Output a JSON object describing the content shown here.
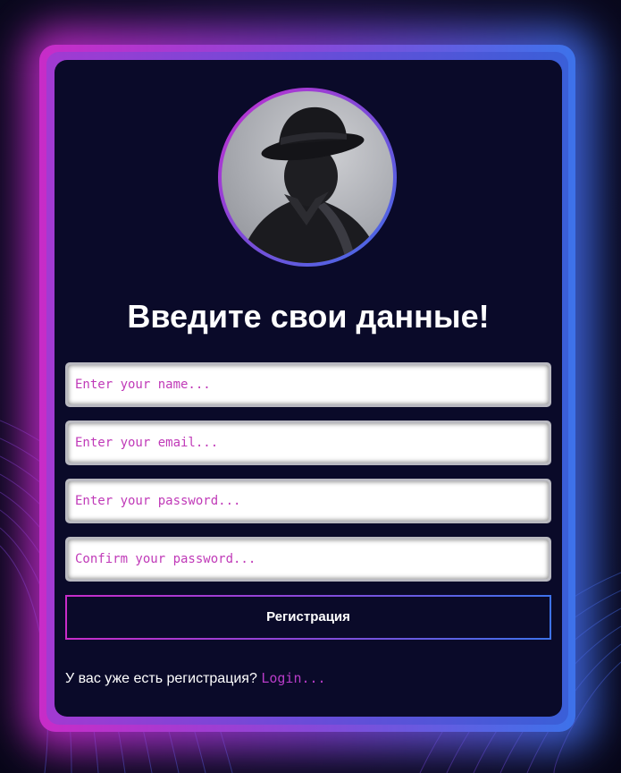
{
  "form": {
    "title": "Введите свои данные!",
    "fields": [
      {
        "placeholder": "Enter your name...",
        "type": "text"
      },
      {
        "placeholder": "Enter your email...",
        "type": "email"
      },
      {
        "placeholder": "Enter your password...",
        "type": "password"
      },
      {
        "placeholder": "Confirm your password...",
        "type": "password"
      }
    ],
    "submit_label": "Регистрация",
    "login_prompt": "У вас уже есть регистрация?",
    "login_link": "Login..."
  },
  "avatar": {
    "icon": "detective-silhouette-icon"
  },
  "colors": {
    "accent_pink": "#c82cc8",
    "accent_purple": "#8848d8",
    "accent_blue": "#3d72ea",
    "card_bg": "#0a0a29",
    "placeholder_text": "#c03ab8"
  }
}
